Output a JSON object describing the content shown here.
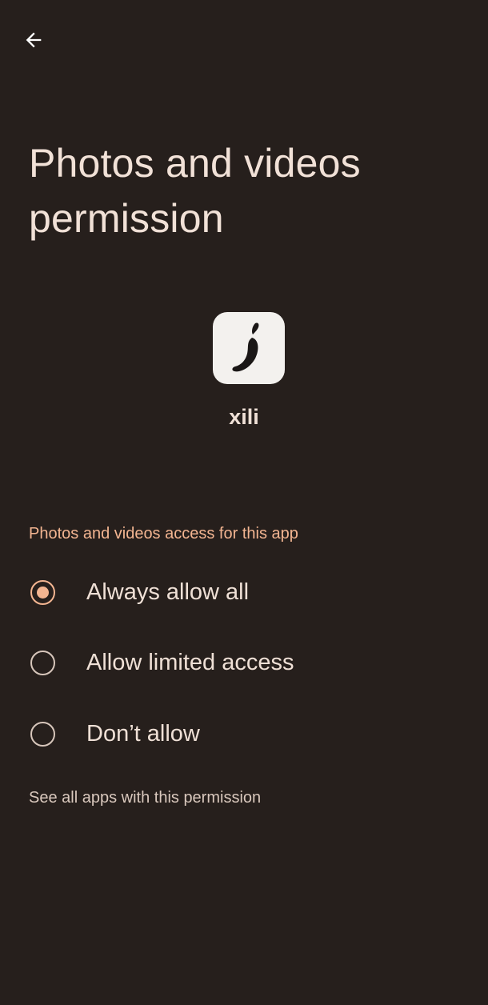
{
  "header": {
    "back_icon": "arrow-left-icon",
    "title": "Photos and videos permission"
  },
  "app": {
    "icon": "chili-pepper-icon",
    "name": "xili"
  },
  "permission": {
    "section_header": "Photos and videos access for this app",
    "options": [
      {
        "label": "Always allow all",
        "selected": true
      },
      {
        "label": "Allow limited access",
        "selected": false
      },
      {
        "label": "Don’t allow",
        "selected": false
      }
    ]
  },
  "footer": {
    "see_all_link": "See all apps with this permission"
  },
  "colors": {
    "background": "#261f1c",
    "accent": "#f3b591",
    "text_primary": "#efe0d6"
  }
}
